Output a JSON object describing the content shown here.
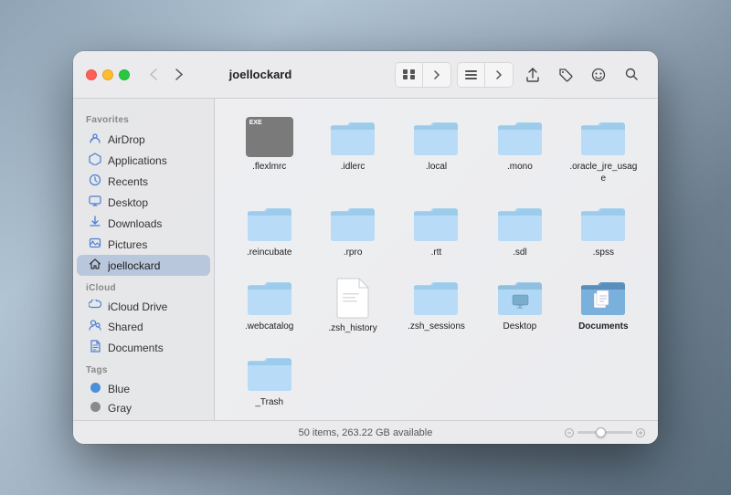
{
  "window": {
    "title": "joellockard"
  },
  "toolbar": {
    "back_label": "‹",
    "forward_label": "›",
    "view_grid_label": "⊞",
    "view_list_label": "⊟",
    "share_label": "↑",
    "tag_label": "⌀",
    "face_label": "☺",
    "search_label": "⌕"
  },
  "sidebar": {
    "favorites_label": "Favorites",
    "icloud_label": "iCloud",
    "tags_label": "Tags",
    "items": [
      {
        "id": "airdrop",
        "label": "AirDrop",
        "icon": "📡"
      },
      {
        "id": "applications",
        "label": "Applications",
        "icon": "🚀"
      },
      {
        "id": "recents",
        "label": "Recents",
        "icon": "🕐"
      },
      {
        "id": "desktop",
        "label": "Desktop",
        "icon": "🖥"
      },
      {
        "id": "downloads",
        "label": "Downloads",
        "icon": "⬇"
      },
      {
        "id": "pictures",
        "label": "Pictures",
        "icon": "🖼"
      },
      {
        "id": "joellockard",
        "label": "joellockard",
        "icon": "🏠",
        "active": true
      }
    ],
    "icloud_items": [
      {
        "id": "icloud-drive",
        "label": "iCloud Drive",
        "icon": "☁"
      },
      {
        "id": "shared",
        "label": "Shared",
        "icon": "📁"
      },
      {
        "id": "documents",
        "label": "Documents",
        "icon": "📄"
      }
    ],
    "tag_items": [
      {
        "id": "blue",
        "label": "Blue",
        "color": "#4a90d9"
      },
      {
        "id": "gray",
        "label": "Gray",
        "color": "#8a8a8a"
      }
    ]
  },
  "files": [
    {
      "id": "flexlmrc",
      "name": ".flexlmrc",
      "type": "special"
    },
    {
      "id": "idlerc",
      "name": ".idlerc",
      "type": "folder"
    },
    {
      "id": "local",
      "name": ".local",
      "type": "folder"
    },
    {
      "id": "mono",
      "name": ".mono",
      "type": "folder"
    },
    {
      "id": "oracle_jre_usage",
      "name": ".oracle_jre_usage",
      "type": "folder"
    },
    {
      "id": "reincubate",
      "name": ".reincubate",
      "type": "folder"
    },
    {
      "id": "rpro",
      "name": ".rpro",
      "type": "folder"
    },
    {
      "id": "rtt",
      "name": ".rtt",
      "type": "folder"
    },
    {
      "id": "sdl",
      "name": ".sdl",
      "type": "folder"
    },
    {
      "id": "spss",
      "name": ".spss",
      "type": "folder"
    },
    {
      "id": "webcatalog",
      "name": ".webcatalog",
      "type": "folder"
    },
    {
      "id": "zsh_history",
      "name": ".zsh_history",
      "type": "file"
    },
    {
      "id": "zsh_sessions",
      "name": ".zsh_sessions",
      "type": "folder"
    },
    {
      "id": "desktop-folder",
      "name": "Desktop",
      "type": "folder-special"
    },
    {
      "id": "documents",
      "name": "Documents",
      "type": "folder-documents",
      "bold": true
    },
    {
      "id": "trash",
      "name": "_Trash",
      "type": "folder"
    }
  ],
  "status": {
    "text": "50 items, 263.22 GB available"
  }
}
